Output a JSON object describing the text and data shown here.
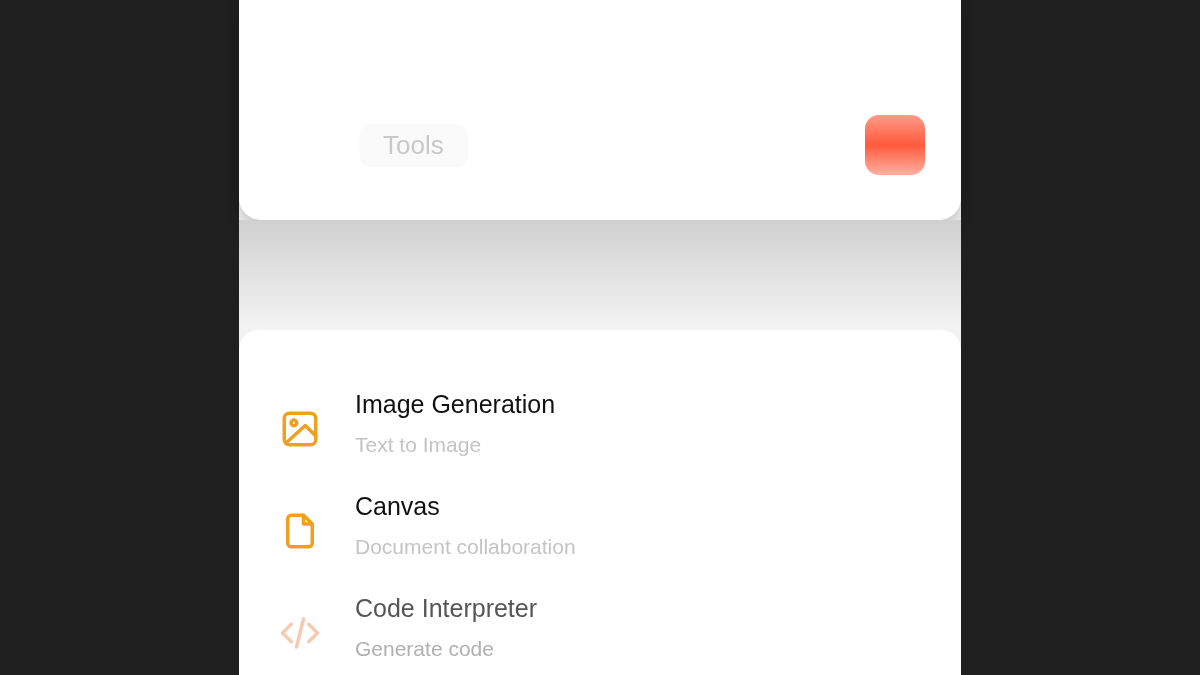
{
  "composer": {
    "chip": "Tools"
  },
  "tools_sheet": {
    "items": [
      {
        "kind": "image",
        "title": "Image Generation",
        "subtitle": "Text to Image"
      },
      {
        "kind": "document",
        "title": "Canvas",
        "subtitle": "Document collaboration"
      },
      {
        "kind": "code",
        "title": "Code Interpreter",
        "subtitle": "Generate code"
      }
    ]
  }
}
